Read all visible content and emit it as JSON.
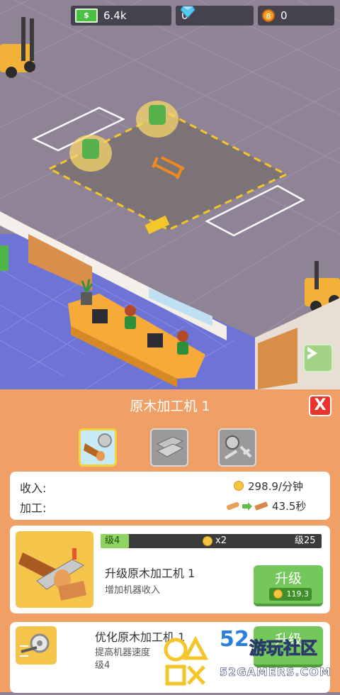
{
  "resources": {
    "cash": {
      "icon": "cash-icon",
      "symbol": "$",
      "value": "6.4k"
    },
    "gems": {
      "icon": "diamond-icon",
      "value": "0"
    },
    "coins": {
      "icon": "coin-icon",
      "symbol": "B",
      "value": "0"
    }
  },
  "panel": {
    "title": "原木加工机 1",
    "close_label": "X",
    "tabs": [
      {
        "icon": "log-tab-icon",
        "active": true
      },
      {
        "icon": "plank-tab-icon",
        "active": false
      },
      {
        "icon": "tools-tab-icon",
        "active": false
      }
    ],
    "stats": {
      "income_label": "收入:",
      "income_value": "298.9/分钟",
      "process_label": "加工:",
      "process_value": "43.5秒"
    },
    "upgrades": [
      {
        "level_start": "级4",
        "multiplier": "x2",
        "level_end": "级25",
        "progress": 0.0,
        "title": "升级原木加工机 1",
        "subtitle": "增加机器收入",
        "button_label": "升级",
        "cost": "119.3"
      },
      {
        "title": "优化原木加工机 1",
        "subtitle": "提高机器速度",
        "level": "级4",
        "button_label": "升级"
      }
    ]
  },
  "watermark": {
    "number": "52",
    "text": "游玩社区",
    "domain": "52GAMERS.COM"
  },
  "colors": {
    "panel_bg": "#f0a066",
    "floor": "#8f8496",
    "button_green": "#74c75a",
    "close_red": "#e8342a"
  }
}
